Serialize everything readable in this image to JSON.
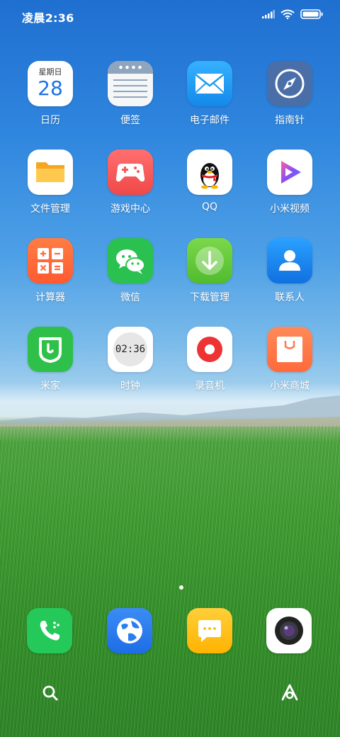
{
  "status_bar": {
    "time": "凌晨2:36"
  },
  "apps": [
    {
      "label": "日历",
      "icon": "calendar-icon"
    },
    {
      "label": "便签",
      "icon": "notes-icon"
    },
    {
      "label": "电子邮件",
      "icon": "mail-icon"
    },
    {
      "label": "指南针",
      "icon": "compass-icon"
    },
    {
      "label": "文件管理",
      "icon": "folder-icon"
    },
    {
      "label": "游戏中心",
      "icon": "gamepad-icon"
    },
    {
      "label": "QQ",
      "icon": "penguin-icon"
    },
    {
      "label": "小米视频",
      "icon": "play-icon"
    },
    {
      "label": "计算器",
      "icon": "calculator-icon"
    },
    {
      "label": "微信",
      "icon": "chat-bubbles-icon"
    },
    {
      "label": "下载管理",
      "icon": "download-icon"
    },
    {
      "label": "联系人",
      "icon": "person-icon"
    },
    {
      "label": "米家",
      "icon": "mijia-icon"
    },
    {
      "label": "时钟",
      "icon": "clock-icon"
    },
    {
      "label": "录音机",
      "icon": "record-icon"
    },
    {
      "label": "小米商城",
      "icon": "shopping-bag-icon"
    }
  ],
  "calendar": {
    "weekday": "星期日",
    "day": "28"
  },
  "clock": {
    "time": "02:36"
  },
  "dock": [
    {
      "icon": "phone-icon"
    },
    {
      "icon": "globe-icon"
    },
    {
      "icon": "message-icon"
    },
    {
      "icon": "camera-icon"
    }
  ],
  "nav": {
    "left_icon": "search-icon",
    "right_icon": "assistant-icon"
  },
  "colors": {
    "calendar_blue": "#1a73e8",
    "mail_blue": "#1e9bf0",
    "compass_slate": "#4a6ea8",
    "game_red": "#f45a5a",
    "video_purple": "#7a4cf0",
    "calc_orange": "#ff6b3d",
    "wechat_green": "#2ac150",
    "download_green": "#63c93a",
    "contacts_blue": "#1b86f0",
    "mijia_green": "#2fc04a",
    "record_red": "#ee3333",
    "mall_orange": "#ff7a4d",
    "phone_green": "#25c95a",
    "browser_blue": "#2a7ef0",
    "msg_yellow": "#ffc21a"
  }
}
